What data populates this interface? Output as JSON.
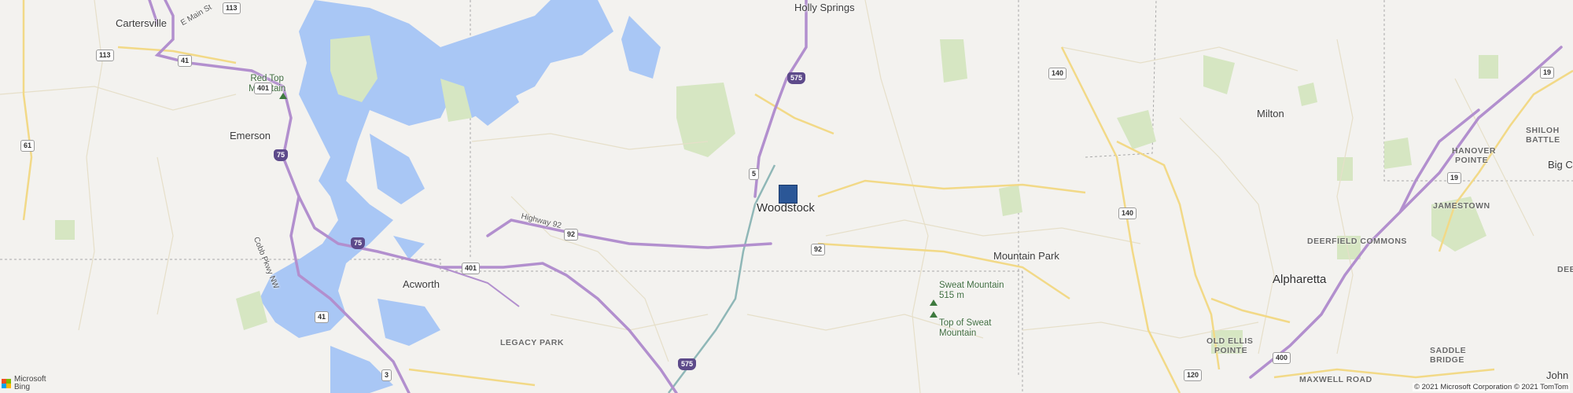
{
  "cities": [
    {
      "key": "cartersville",
      "name": "Cartersville"
    },
    {
      "key": "holly_springs",
      "name": "Holly Springs"
    },
    {
      "key": "emerson",
      "name": "Emerson"
    },
    {
      "key": "woodstock",
      "name": "Woodstock"
    },
    {
      "key": "milton",
      "name": "Milton"
    },
    {
      "key": "mountain_park",
      "name": "Mountain Park"
    },
    {
      "key": "acworth",
      "name": "Acworth"
    },
    {
      "key": "alpharetta",
      "name": "Alpharetta"
    },
    {
      "key": "big_c",
      "name": "Big C"
    },
    {
      "key": "johns",
      "name": "John"
    }
  ],
  "neighborhoods": {
    "legacy_park": "LEGACY PARK",
    "shiloh": "SHILOH",
    "battle": "BATTLE",
    "hanover": "HANOVER",
    "pointe": "POINTE",
    "jamestown": "JAMESTOWN",
    "deerfield": "DEERFIELD COMMONS",
    "old_ellis": "OLD ELLIS",
    "old_ellis_pointe": "POINTE",
    "saddle": "SADDLE",
    "bridge": "BRIDGE",
    "maxwell": "MAXWELL ROAD",
    "dee": "DEE"
  },
  "peaks": {
    "red_top": "Red Top",
    "red_top2": "Mountain",
    "sweat": "Sweat Mountain",
    "sweat_elev": "515 m",
    "top_sweat": "Top of Sweat",
    "top_sweat2": "Mountain"
  },
  "roads": {
    "e_main": "E Main St",
    "cobb": "Cobb Pkwy NW",
    "highway92": "Highway 92"
  },
  "shields": {
    "s113a": "113",
    "s113b": "113",
    "s401a": "401",
    "s41a": "41",
    "s61": "61",
    "s75a": "75",
    "s75b": "75",
    "s401b": "401",
    "s41b": "41",
    "s3": "3",
    "s575a": "575",
    "s575b": "575",
    "s5": "5",
    "s92a": "92",
    "s92b": "92",
    "s140a": "140",
    "s140b": "140",
    "s19a": "19",
    "s19b": "19",
    "s400": "400",
    "s120": "120"
  },
  "branding": {
    "logo_line1": "Microsoft",
    "logo_line2": "Bing",
    "copyright": "© 2021 Microsoft Corporation © 2021 TomTom",
    "logo_colors": [
      "#f25022",
      "#7fba00",
      "#00a4ef",
      "#ffb900"
    ]
  },
  "colors": {
    "land": "#f3f2ef",
    "water": "#a9c7f5",
    "park": "#d6e6c2",
    "interstate": "#b28fce",
    "highway": "#f2d987",
    "rail": "#8fb7b7",
    "pin": "#2b5797"
  },
  "marker": {
    "name": "Woodstock location pin"
  }
}
